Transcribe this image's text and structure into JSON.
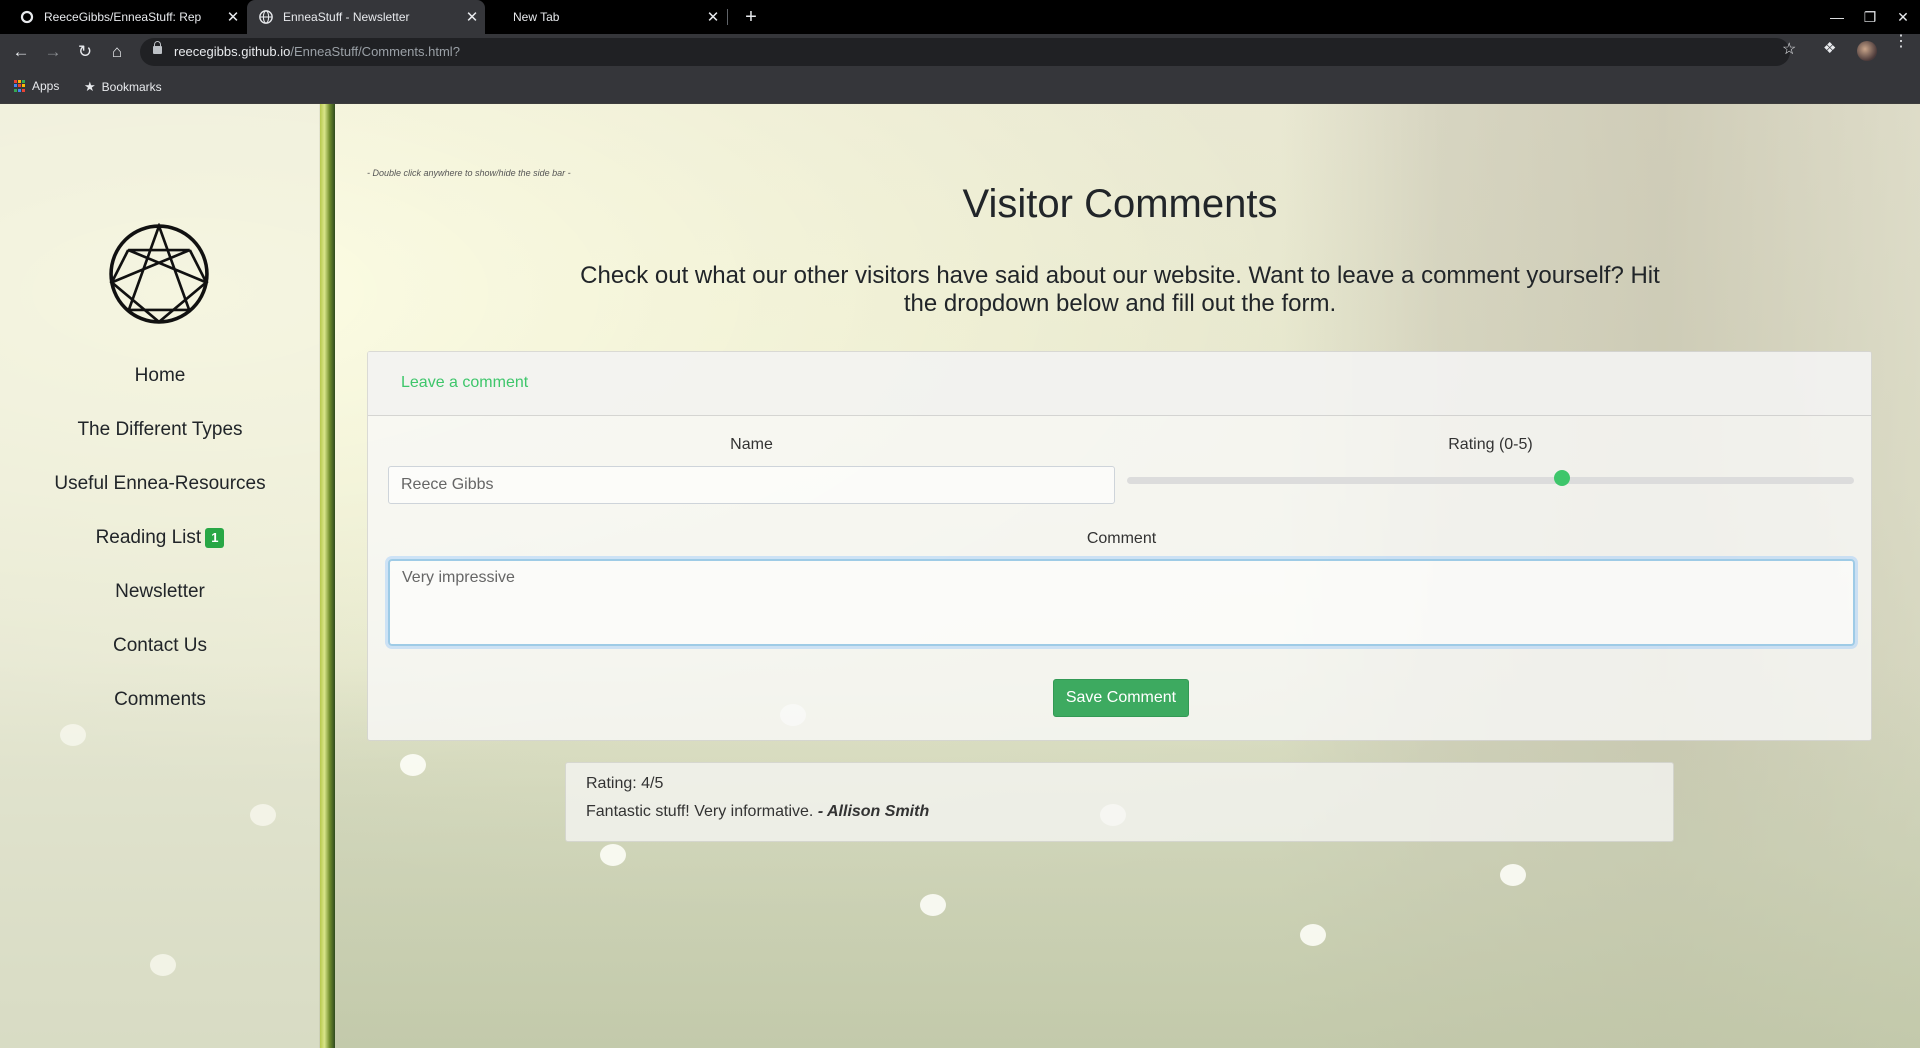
{
  "browser": {
    "tabs": [
      {
        "title": "ReeceGibbs/EnneaStuff: Rep",
        "active": false,
        "icon": "github-icon"
      },
      {
        "title": "EnneaStuff - Newsletter",
        "active": true,
        "icon": "globe-icon"
      },
      {
        "title": "New Tab",
        "active": false,
        "icon": ""
      }
    ],
    "url_host": "reecegibbs.github.io",
    "url_path": "/EnneaStuff/Comments.html?",
    "bookmarks": [
      {
        "label": "Apps",
        "icon": "apps-grid-icon"
      },
      {
        "label": "Bookmarks",
        "icon": "star-icon"
      }
    ]
  },
  "sidebar": {
    "logo": "enneagram-logo",
    "items": [
      {
        "label": "Home"
      },
      {
        "label": "The Different Types"
      },
      {
        "label": "Useful Ennea-Resources"
      },
      {
        "label": "Reading List",
        "badge": "1"
      },
      {
        "label": "Newsletter"
      },
      {
        "label": "Contact Us"
      },
      {
        "label": "Comments"
      }
    ]
  },
  "main": {
    "hint": "- Double click anywhere to show/hide the side bar -",
    "title": "Visitor Comments",
    "intro": "Check out what our other visitors have said about our website. Want to leave a comment yourself? Hit the dropdown below and fill out the form.",
    "form": {
      "toggle_label": "Leave a comment",
      "name_label": "Name",
      "name_value": "Reece Gibbs",
      "rating_label": "Rating (0-5)",
      "rating_min": 0,
      "rating_max": 5,
      "rating_value": 3,
      "comment_label": "Comment",
      "comment_value": "Very impressive",
      "save_label": "Save Comment"
    },
    "comments": [
      {
        "rating_text": "Rating: 4/5",
        "text": "Fantastic stuff! Very informative.",
        "author": "- Allison Smith"
      }
    ]
  },
  "colors": {
    "accent": "#3ec66b",
    "button": "#3daa60",
    "badge": "#28a745"
  }
}
